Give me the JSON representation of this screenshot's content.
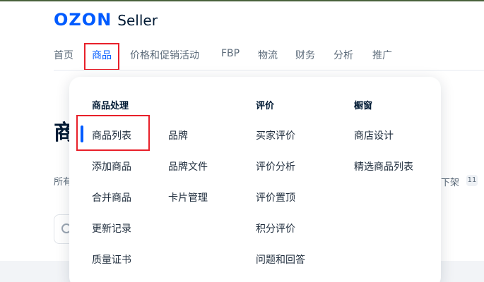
{
  "brand": {
    "logo_text": "OZON",
    "product": "Seller",
    "accent_color": "#005bff"
  },
  "nav": {
    "items": [
      "首页",
      "商品",
      "价格和促销活动",
      "FBP",
      "物流",
      "财务",
      "分析",
      "推广"
    ],
    "active_index": 1
  },
  "background_page": {
    "title_partial": "商",
    "tab_partial": "所有",
    "right_text_partial": "下架",
    "right_badge": "11"
  },
  "dropdown": {
    "columns": [
      {
        "header": "商品处理",
        "items": [
          "商品列表",
          "添加商品",
          "合并商品",
          "更新记录",
          "质量证书"
        ]
      },
      {
        "header": "",
        "items": [
          "品牌",
          "品牌文件",
          "卡片管理"
        ]
      },
      {
        "header": "评价",
        "items": [
          "买家评价",
          "评价分析",
          "评价置顶",
          "积分评价",
          "问题和回答"
        ]
      },
      {
        "header": "橱窗",
        "items": [
          "商店设计",
          "精选商品列表"
        ]
      }
    ],
    "active_item": "商品列表",
    "highlight_color": "#e8202a"
  }
}
